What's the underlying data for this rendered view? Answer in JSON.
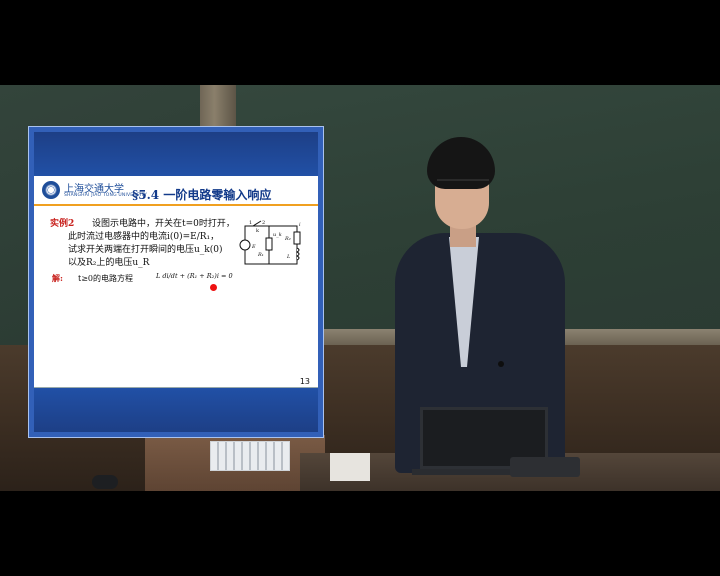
{
  "slide": {
    "university_name": "上海交通大学",
    "university_sub": "SHANGHAI JIAO TONG UNIVERSITY",
    "title": "§5.4  一阶电路零输入响应",
    "example_label": "实例2",
    "lines": [
      "设图示电路中，开关在t=0时打开，",
      "此时流过电感器中的电流i(0)=E/R₁，",
      "试求开关两端在打开瞬间的电压u_k(0)",
      "以及R₂上的电压u_R"
    ],
    "solution_label": "解:",
    "solution_text": "t≥0的电路方程",
    "equation": "L di/dt + (R₁ + R₂)i = 0",
    "page_number": "13",
    "circuit_labels": {
      "switch_1": "1",
      "switch_2": "2",
      "switch_k": "k",
      "source": "E",
      "r1": "R₁",
      "r2": "R₂",
      "uk": "u_k",
      "inductor": "L",
      "current": "i"
    }
  },
  "colors": {
    "slide_blue": "#2150a6",
    "title_blue": "#123a8a",
    "accent_orange": "#f0a020",
    "label_red": "#c8201c"
  }
}
